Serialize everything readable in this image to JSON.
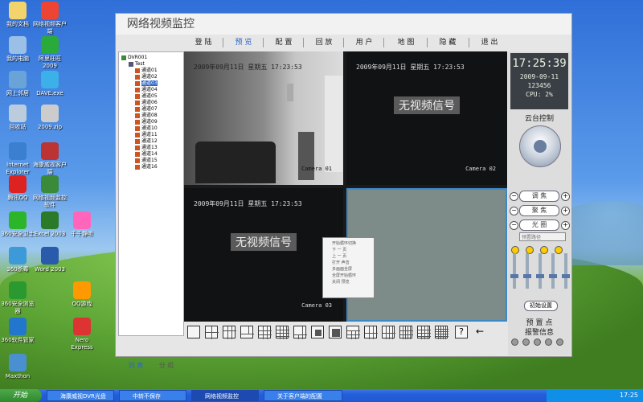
{
  "desktop": {
    "icons": [
      {
        "label": "我的文档"
      },
      {
        "label": "我的电脑"
      },
      {
        "label": "网上邻居"
      },
      {
        "label": "回收站"
      },
      {
        "label": "Internet Explorer"
      },
      {
        "label": "腾讯QQ"
      },
      {
        "label": "360安全卫士"
      },
      {
        "label": "360杀毒"
      },
      {
        "label": "360安全浏览器"
      },
      {
        "label": "360软件管家"
      },
      {
        "label": "Maxthon"
      },
      {
        "label": "网络视频客户端"
      },
      {
        "label": "阿里旺旺2009"
      },
      {
        "label": "DAVE.exe"
      },
      {
        "label": "2009.zip"
      },
      {
        "label": "海康威视客户端"
      },
      {
        "label": "网络视频监控软件"
      },
      {
        "label": "Excel 2003"
      },
      {
        "label": "Word 2003"
      },
      {
        "label": "Nero Express"
      },
      {
        "label": "QQ游戏"
      },
      {
        "label": "千千静听"
      }
    ]
  },
  "app": {
    "title": "网络视频监控",
    "menu": [
      {
        "label": "登 陆"
      },
      {
        "label": "预 览"
      },
      {
        "label": "配 置"
      },
      {
        "label": "回 放"
      },
      {
        "label": "用 户"
      },
      {
        "label": "地 图"
      },
      {
        "label": "隐 藏"
      },
      {
        "label": "退 出"
      }
    ],
    "tree": {
      "root": "DVR001",
      "group": "Test",
      "channels": [
        "通道01",
        "通道02",
        "通道03",
        "通道04",
        "通道05",
        "通道06",
        "通道07",
        "通道08",
        "通道09",
        "通道10",
        "通道11",
        "通道12",
        "通道13",
        "通道14",
        "通道15",
        "通道16"
      ],
      "selected_index": 2
    },
    "tree_tabs": [
      {
        "label": "列 表"
      },
      {
        "label": "分 组"
      }
    ],
    "panes": [
      {
        "timestamp": "2009年09月11日  星期五  17:23:53",
        "camera": "Camera 01",
        "no_signal": ""
      },
      {
        "timestamp": "2009年09月11日  星期五  17:23:53",
        "camera": "Camera 02",
        "no_signal": "无视频信号"
      },
      {
        "timestamp": "2009年09月11日  星期五  17:23:53",
        "camera": "Camera 03",
        "no_signal": "无视频信号"
      },
      {
        "timestamp": "",
        "camera": "",
        "no_signal": ""
      }
    ],
    "context_menu": [
      "开始循环切换",
      "下 一 页",
      "上 一 页",
      "打开  声音",
      "多画面全屏",
      "全屏开始循环",
      "关闭  预览"
    ],
    "layout_help": "?",
    "layout_arrow": "←",
    "clock": {
      "time": "17:25:39",
      "date": "2009-09-11",
      "number": "123456",
      "cpu": "CPU: 2%"
    },
    "ptz": {
      "title": "云台控制",
      "zoom": "调 焦",
      "focus": "聚 焦",
      "iris": "光 圈",
      "preset_select": "预置路径",
      "lock_button": "初始设置",
      "preset_label": "预 置 点",
      "alarm_label": "报警信息"
    }
  },
  "taskbar": {
    "start": "开始",
    "buttons": [
      {
        "label": "海康威视DVR光盘"
      },
      {
        "label": "中转不保存"
      },
      {
        "label": "网络视频监控"
      },
      {
        "label": "关于客户端的配置"
      }
    ],
    "clock": "17:25"
  },
  "colors": {
    "accent": "#2a66c9",
    "selected_pane": "#3b88c8",
    "clock_bg": "#3a3f45"
  }
}
